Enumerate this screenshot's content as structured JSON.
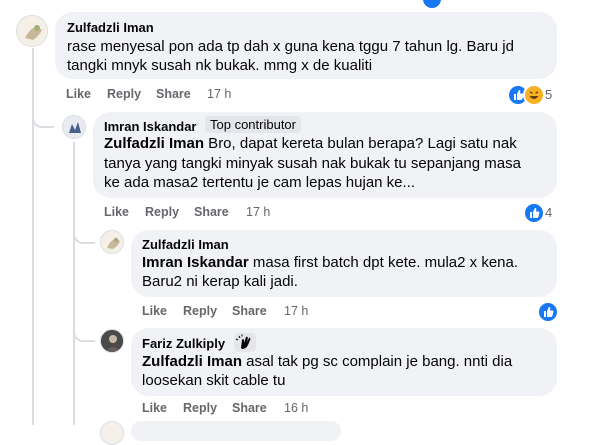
{
  "comments": [
    {
      "author": "Zulfadzli Iman",
      "lines": [
        "rase menyesal pon ada tp dah x guna kena tggu 7 tahun lg. Baru jd",
        "tangki mnyk susah nk bukak. mmg x de kualiti"
      ],
      "actions": {
        "like": "Like",
        "reply": "Reply",
        "share": "Share"
      },
      "time": "17 h",
      "reactions": {
        "icons": [
          "like-icon",
          "haha-icon"
        ],
        "count": "5"
      }
    },
    {
      "author": "Imran Iskandar",
      "badge": "Top contributor",
      "mention": "Zulfadzli Iman",
      "line1_rest": " Bro, dapat kereta bulan berapa? Lagi satu nak",
      "lines": [
        "tanya yang tangki minyak susah nak bukak tu sepanjang masa",
        "ke ada masa2 tertentu je cam lepas hujan ke..."
      ],
      "actions": {
        "like": "Like",
        "reply": "Reply",
        "share": "Share"
      },
      "time": "17 h",
      "reactions": {
        "icons": [
          "like-icon"
        ],
        "count": "4"
      }
    },
    {
      "author": "Zulfadzli Iman",
      "mention": "Imran Iskandar",
      "line1_rest": " masa first batch dpt kete. mula2 x kena.",
      "lines": [
        "Baru2 ni kerap kali jadi."
      ],
      "actions": {
        "like": "Like",
        "reply": "Reply",
        "share": "Share"
      },
      "time": "17 h",
      "reactions": {
        "icons": [
          "like-icon"
        ],
        "count": ""
      }
    },
    {
      "author": "Fariz Zulkiply",
      "badge_icon": "clapping-hands-icon",
      "mention": "Zulfadzli Iman",
      "line1_rest": " asal tak pg sc complain je bang. nnti dia",
      "lines": [
        "loosekan skit cable tu"
      ],
      "actions": {
        "like": "Like",
        "reply": "Reply",
        "share": "Share"
      },
      "time": "16 h"
    }
  ],
  "colors": {
    "like_blue": "#1877f2",
    "haha_yellow": "#f7b125",
    "bubble_bg": "#f0f2f5",
    "meta_gray": "#65676b"
  }
}
